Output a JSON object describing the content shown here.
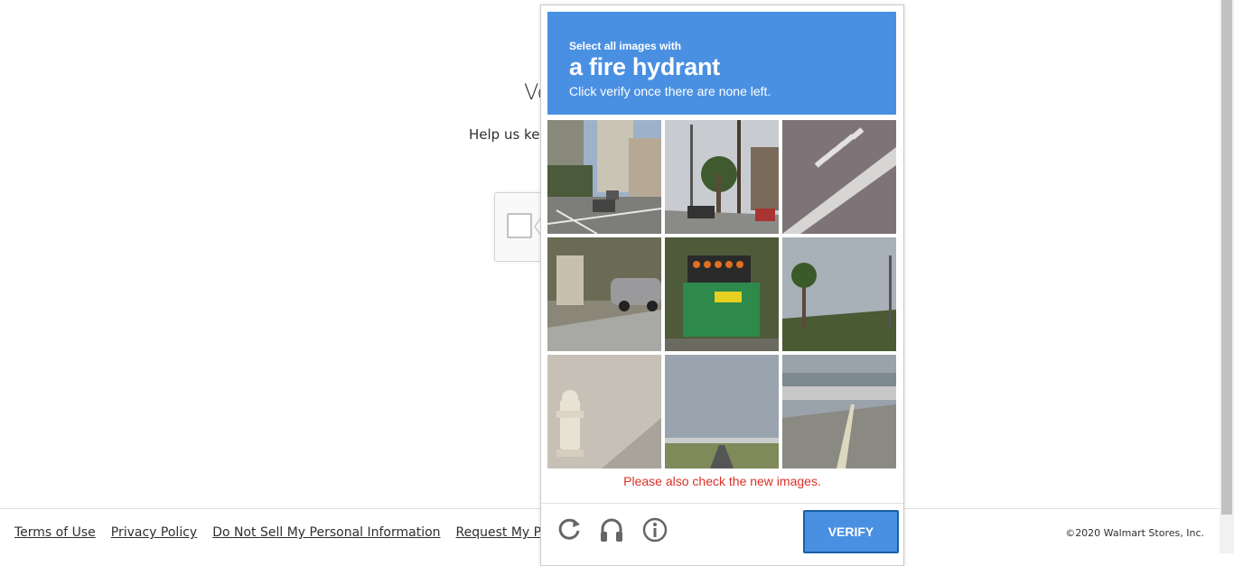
{
  "page": {
    "title_partial": "Ve",
    "subtitle_partial": "Help us kee"
  },
  "captcha": {
    "instruction_small": "Select all images with",
    "target": "a fire hydrant",
    "instruction_note": "Click verify once there are none left.",
    "new_images_message": "Please also check the new images.",
    "verify_label": "VERIFY",
    "controls": [
      "reload-icon",
      "audio-icon",
      "info-icon"
    ],
    "header_color": "#4a90e2",
    "error_color": "#d93025"
  },
  "footer": {
    "links": [
      "Terms of Use",
      "Privacy Policy",
      "Do Not Sell My Personal Information",
      "Request My Personal In"
    ],
    "copyright": "©2020 Walmart Stores, Inc."
  }
}
